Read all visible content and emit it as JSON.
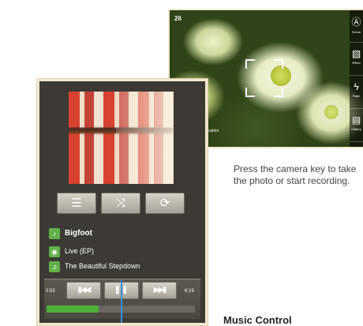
{
  "camera": {
    "frame_counter": "26",
    "status": "Searching for location",
    "side_buttons": [
      {
        "label": "Scene",
        "icon": "scene-icon"
      },
      {
        "label": "Effect",
        "icon": "effect-icon"
      },
      {
        "label": "Flash",
        "icon": "flash-icon"
      },
      {
        "label": "Gallery",
        "icon": "gallery-icon"
      }
    ]
  },
  "caption": {
    "text": "Press the camera key to take the photo or start recording."
  },
  "bottom_heading": "Music Control",
  "player": {
    "controls": [
      {
        "name": "list",
        "glyph": "☰"
      },
      {
        "name": "shuffle",
        "glyph": "⤨"
      },
      {
        "name": "repeat",
        "glyph": "⟳"
      }
    ],
    "artist": "Bigfoot",
    "album": "Live (EP)",
    "song": "The Beautiful Stepdown",
    "elapsed": "0:53",
    "duration": "6:19",
    "progress_fraction": 0.35,
    "accent_color": "#4fb03a"
  }
}
